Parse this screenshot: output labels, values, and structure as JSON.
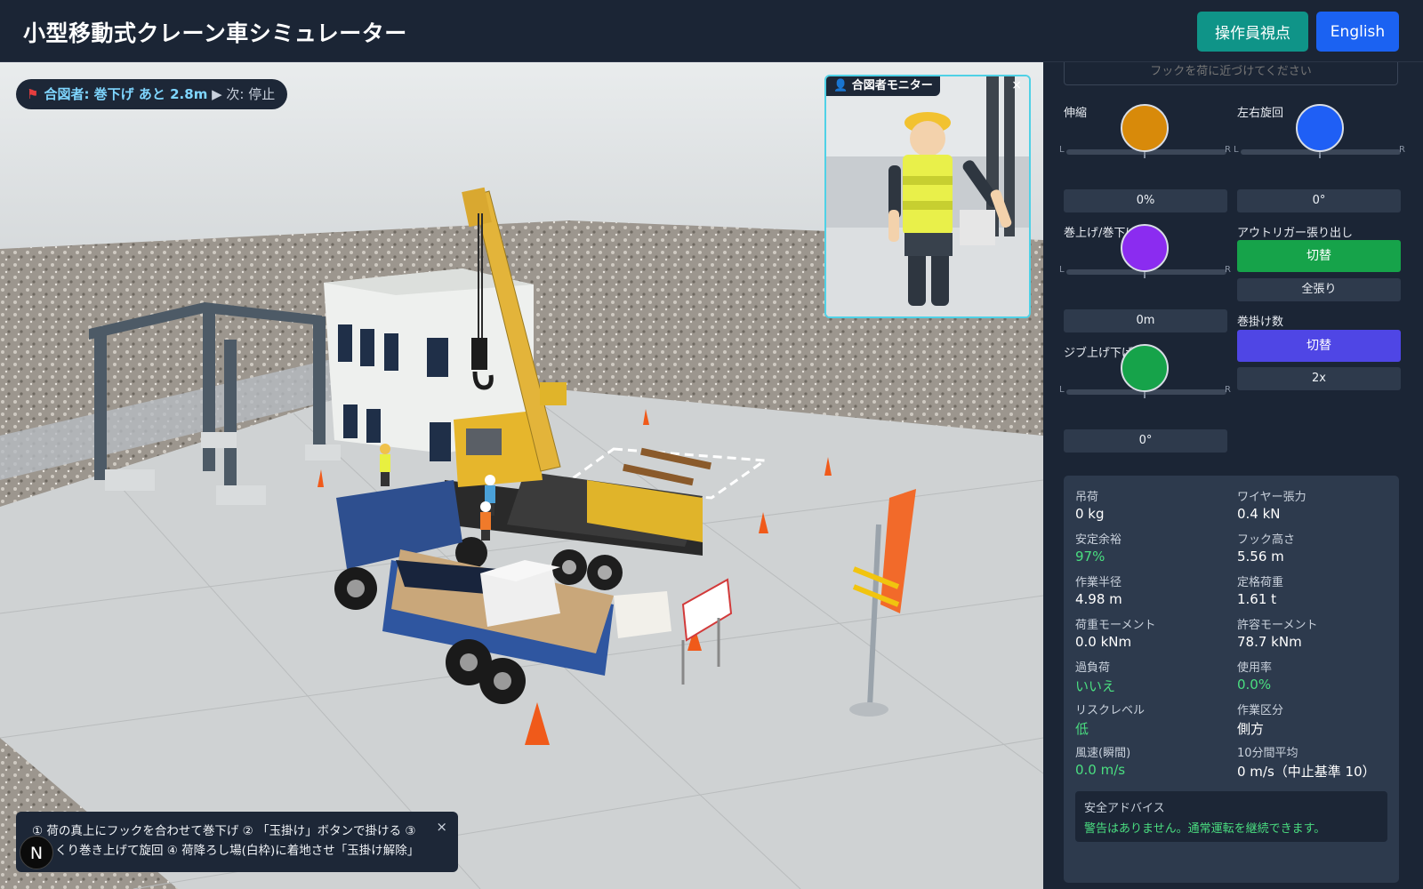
{
  "header": {
    "title": "小型移動式クレーン車シミュレーター",
    "view_button": "操作員視点",
    "lang_button": "English"
  },
  "scene": {
    "signal": {
      "flag_icon": "flag-icon",
      "main": "合図者: 巻下げ あと 2.8m",
      "next": "▶ 次: 停止"
    },
    "monitor": {
      "label": "👤 合図者モニター",
      "close": "×"
    },
    "help": {
      "line1": "① 荷の真上にフックを合わせて巻下げ ② 「玉掛け」ボタンで掛ける ③",
      "line2": "くり巻き上げて旋回 ④ 荷降ろし場(白枠)に着地させ「玉掛け解除」",
      "close": "×"
    },
    "badge": "N"
  },
  "controls": {
    "hint_placeholder": "フックを荷に近づけてください",
    "telescope": {
      "label": "伸縮",
      "value": "0%",
      "color": "#d88a0a"
    },
    "swing": {
      "label": "左右旋回",
      "value": "0°",
      "color": "#1f5ff5"
    },
    "hoist": {
      "label": "巻上げ/巻下げ",
      "value": "0m",
      "color": "#8b2cf0"
    },
    "outrigger": {
      "label": "アウトリガー張り出し",
      "button": "切替",
      "value": "全張り"
    },
    "jib": {
      "label": "ジブ上げ下げ",
      "value": "0°",
      "color": "#16a34a"
    },
    "falls": {
      "label": "巻掛け数",
      "button": "切替",
      "value": "2x"
    },
    "left_mark": "L",
    "right_mark": "R"
  },
  "stats": {
    "load": {
      "label": "吊荷",
      "value": "0 kg"
    },
    "wire_tension": {
      "label": "ワイヤー張力",
      "value": "0.4 kN"
    },
    "stability": {
      "label": "安定余裕",
      "value": "97%"
    },
    "hook_height": {
      "label": "フック高さ",
      "value": "5.56 m"
    },
    "radius": {
      "label": "作業半径",
      "value": "4.98 m"
    },
    "rated_load": {
      "label": "定格荷重",
      "value": "1.61 t"
    },
    "load_moment": {
      "label": "荷重モーメント",
      "value": "0.0 kNm"
    },
    "allowed_moment": {
      "label": "許容モーメント",
      "value": "78.7 kNm"
    },
    "overload": {
      "label": "過負荷",
      "value": "いいえ"
    },
    "usage": {
      "label": "使用率",
      "value": "0.0%"
    },
    "risk": {
      "label": "リスクレベル",
      "value": "低"
    },
    "work_zone": {
      "label": "作業区分",
      "value": "側方"
    },
    "wind_gust": {
      "label": "風速(瞬間)",
      "value": "0.0 m/s"
    },
    "wind_avg": {
      "label": "10分間平均",
      "value": "0 m/s（中止基準 10）"
    },
    "advice": {
      "label": "安全アドバイス",
      "value": "警告はありません。通常運転を継続できます。"
    }
  }
}
